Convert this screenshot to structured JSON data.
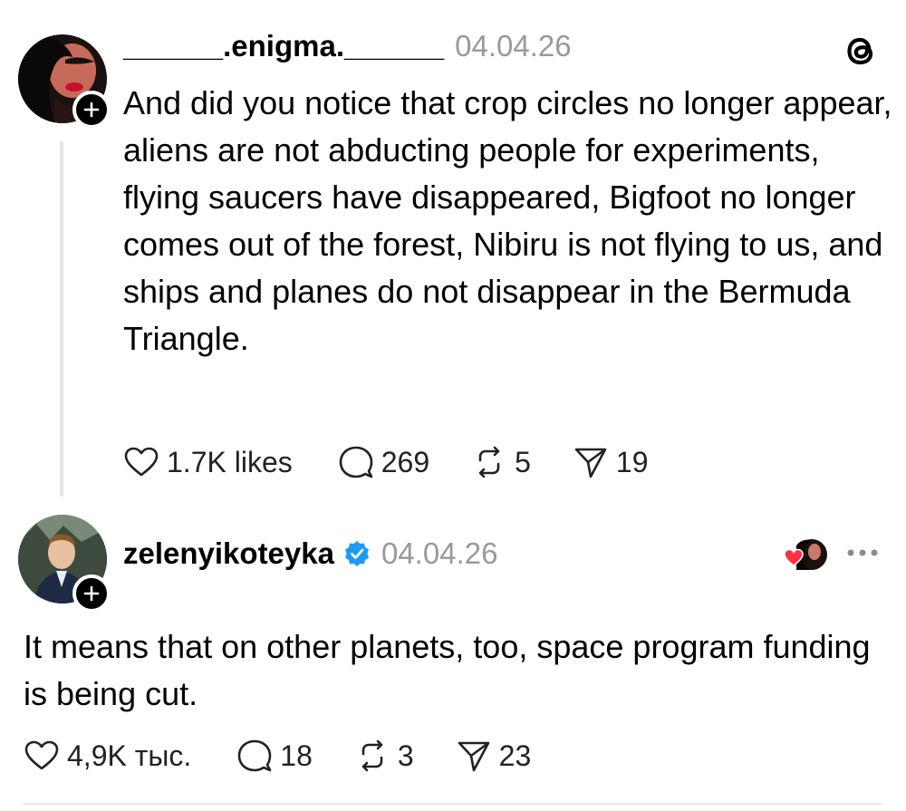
{
  "posts": [
    {
      "username": "______.enigma.______",
      "date": "04.04.26",
      "text": "And did you notice that crop circles no longer appear, aliens are not abducting people for experiments, flying saucers have disappeared, Bigfoot no longer comes out of the forest, Nibiru is not flying to us, and ships and planes do not disappear in the Bermuda Triangle.",
      "likes": "1.7K likes",
      "replies": "269",
      "reposts": "5",
      "shares": "19"
    },
    {
      "username": "zelenyikoteyka",
      "date": "04.04.26",
      "verified": true,
      "text": "It means that on other planets, too, space program funding is being cut.",
      "likes": "4,9K тыс.",
      "replies": "18",
      "reposts": "3",
      "shares": "23"
    }
  ],
  "icons": {
    "app_logo": "threads-logo-icon",
    "like": "heart-icon",
    "reply": "comment-icon",
    "repost": "repost-icon",
    "share": "send-icon",
    "more": "more-dots-icon",
    "follow": "plus-icon",
    "verified": "verified-badge-icon"
  },
  "colors": {
    "text": "#000000",
    "muted": "#999999",
    "verified": "#1d9bf0",
    "liked_heart": "#ff3040"
  }
}
